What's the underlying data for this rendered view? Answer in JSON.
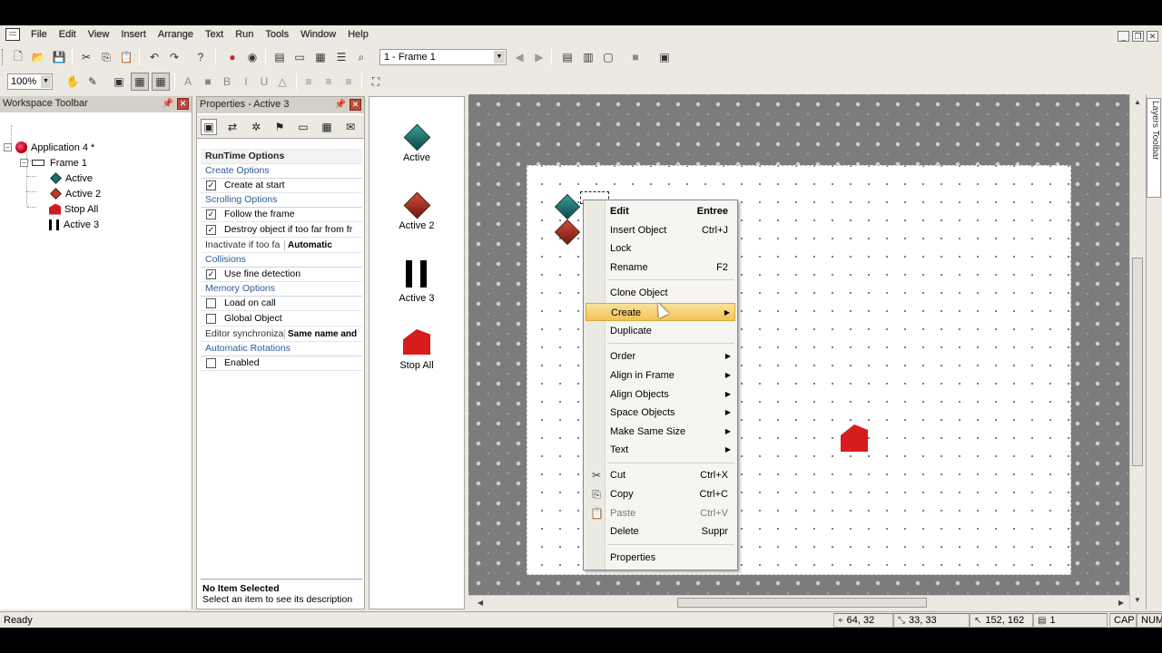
{
  "menubar": {
    "items": [
      "File",
      "Edit",
      "View",
      "Insert",
      "Arrange",
      "Text",
      "Run",
      "Tools",
      "Window",
      "Help"
    ]
  },
  "toolbar": {
    "frame_select": "1 - Frame 1",
    "zoom": "100%"
  },
  "workspace": {
    "title": "Workspace Toolbar",
    "tree": {
      "app": "Application 4 *",
      "frame": "Frame 1",
      "objects": [
        "Active",
        "Active 2",
        "Stop All",
        "Active 3"
      ]
    }
  },
  "properties": {
    "title": "Properties - Active 3",
    "rows": {
      "runtime": "RunTime Options",
      "create_options": "Create Options",
      "create_at_start": "Create at start",
      "scrolling_options": "Scrolling Options",
      "follow_frame": "Follow the frame",
      "destroy_far": "Destroy object if too far from fr",
      "inactivate_label": "Inactivate if too fa",
      "inactivate_value": "Automatic",
      "collisions": "Collisions",
      "fine_detection": "Use fine detection",
      "memory_options": "Memory Options",
      "load_on_call": "Load on call",
      "global_object": "Global Object",
      "editor_sync_label": "Editor synchroniza",
      "editor_sync_value": "Same name and",
      "auto_rotations": "Automatic Rotations",
      "enabled": "Enabled"
    },
    "desc_title": "No Item Selected",
    "desc_text": "Select an item to see its description"
  },
  "shelf": {
    "items": [
      "Active",
      "Active 2",
      "Active 3",
      "Stop All"
    ]
  },
  "layers_toolbar": "Layers Toolbar",
  "context_menu": {
    "edit": "Edit",
    "edit_sc": "Entree",
    "insert_object": "Insert Object",
    "insert_object_sc": "Ctrl+J",
    "lock": "Lock",
    "rename": "Rename",
    "rename_sc": "F2",
    "clone": "Clone Object",
    "create": "Create",
    "duplicate": "Duplicate",
    "order": "Order",
    "align_frame": "Align in Frame",
    "align_objects": "Align Objects",
    "space_objects": "Space Objects",
    "same_size": "Make Same Size",
    "text": "Text",
    "cut": "Cut",
    "cut_sc": "Ctrl+X",
    "copy": "Copy",
    "copy_sc": "Ctrl+C",
    "paste": "Paste",
    "paste_sc": "Ctrl+V",
    "delete": "Delete",
    "delete_sc": "Suppr",
    "properties": "Properties"
  },
  "statusbar": {
    "status": "Ready",
    "pos": "64, 32",
    "size": "33, 33",
    "cursor": "152, 162",
    "layer": "1",
    "cap": "CAP",
    "num": "NUM"
  }
}
